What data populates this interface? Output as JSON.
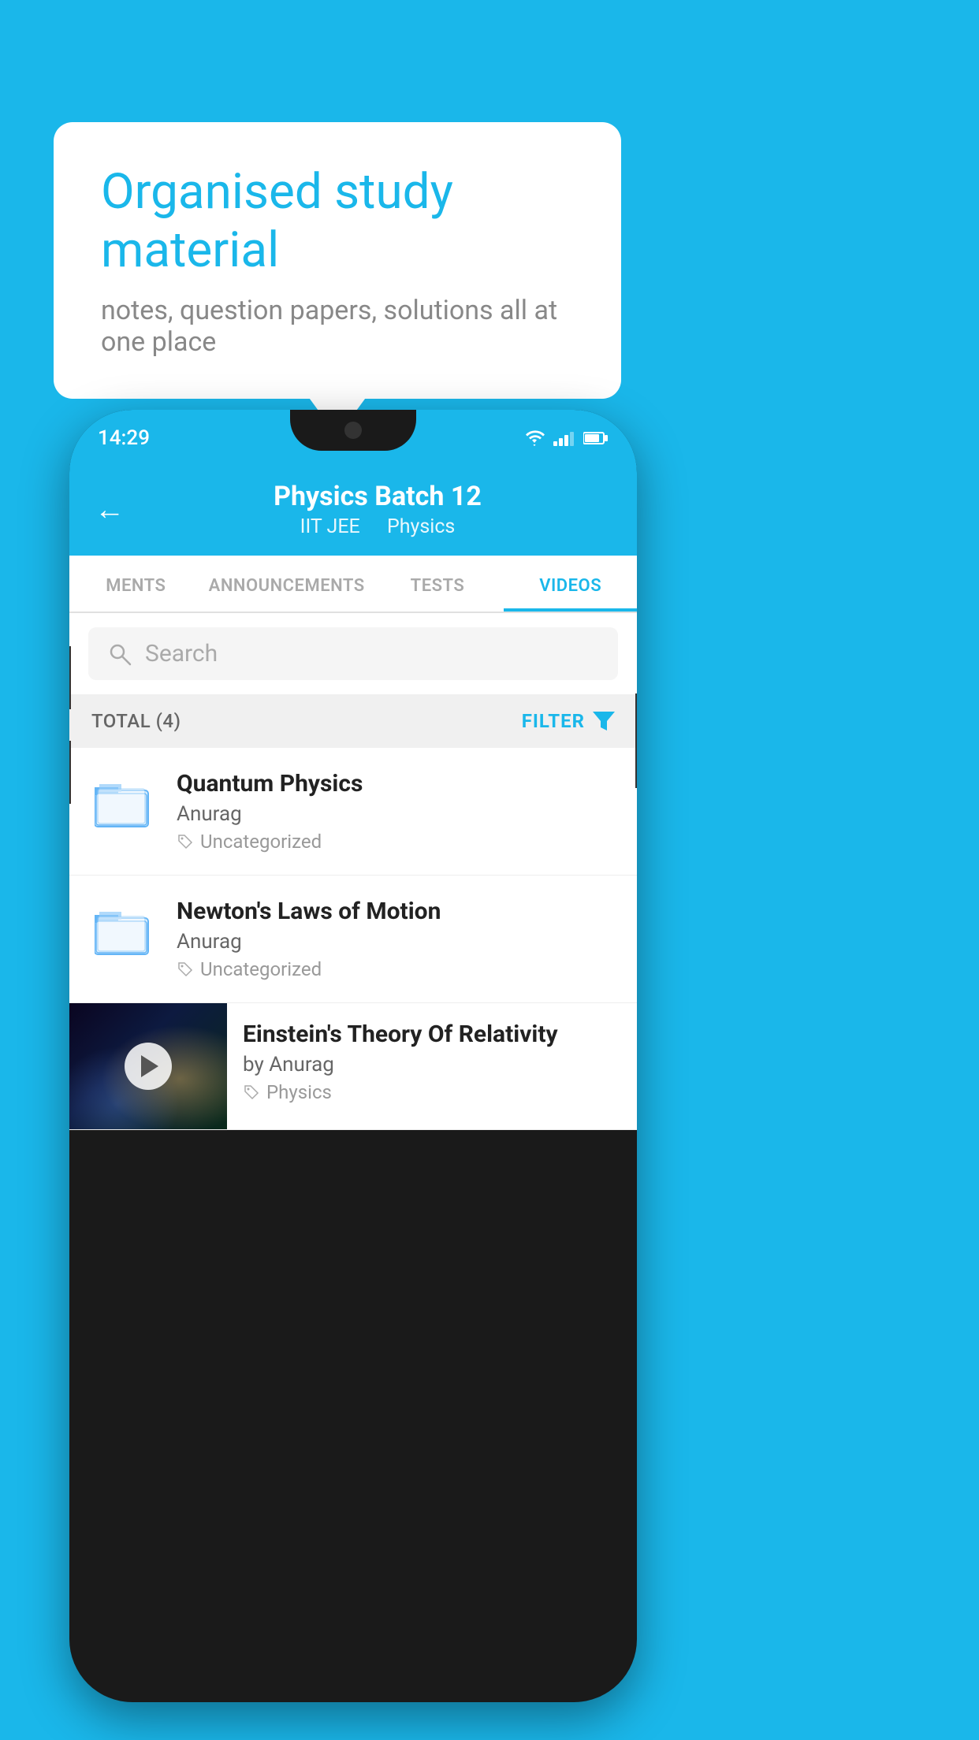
{
  "background_color": "#1ab7ea",
  "speech_bubble": {
    "title": "Organised study material",
    "subtitle": "notes, question papers, solutions all at one place"
  },
  "phone": {
    "status_bar": {
      "time": "14:29"
    },
    "header": {
      "title": "Physics Batch 12",
      "subtitle_part1": "IIT JEE",
      "subtitle_part2": "Physics",
      "back_label": "←"
    },
    "tabs": [
      {
        "label": "MENTS",
        "active": false
      },
      {
        "label": "ANNOUNCEMENTS",
        "active": false
      },
      {
        "label": "TESTS",
        "active": false
      },
      {
        "label": "VIDEOS",
        "active": true
      }
    ],
    "search": {
      "placeholder": "Search"
    },
    "filter_row": {
      "total_label": "TOTAL (4)",
      "filter_label": "FILTER"
    },
    "items": [
      {
        "title": "Quantum Physics",
        "author": "Anurag",
        "tag": "Uncategorized",
        "type": "folder"
      },
      {
        "title": "Newton's Laws of Motion",
        "author": "Anurag",
        "tag": "Uncategorized",
        "type": "folder"
      },
      {
        "title": "Einstein's Theory Of Relativity",
        "author": "by Anurag",
        "tag": "Physics",
        "type": "video"
      }
    ]
  }
}
